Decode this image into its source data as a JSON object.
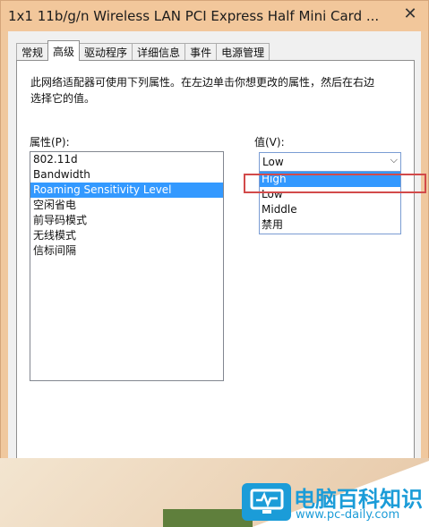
{
  "window": {
    "title": "1x1 11b/g/n Wireless LAN PCI Express Half Mini Card ...",
    "close_glyph": "✕"
  },
  "tabs": [
    {
      "label": "常规"
    },
    {
      "label": "高级"
    },
    {
      "label": "驱动程序"
    },
    {
      "label": "详细信息"
    },
    {
      "label": "事件"
    },
    {
      "label": "电源管理"
    }
  ],
  "advanced": {
    "description": "此网络适配器可使用下列属性。在左边单击你想更改的属性，然后在右边选择它的值。",
    "property_label": "属性(P):",
    "value_label": "值(V):",
    "properties": [
      "802.11d",
      "Bandwidth",
      "Roaming Sensitivity Level",
      "空闲省电",
      "前导码模式",
      "无线模式",
      "信标间隔"
    ],
    "selected_property": "Roaming Sensitivity Level",
    "current_value": "Low",
    "value_options": [
      "High",
      "Low",
      "Middle",
      "禁用"
    ],
    "highlighted_option": "High"
  },
  "watermark": {
    "name": "电脑百科知识",
    "url": "www.pc-daily.com"
  },
  "colors": {
    "selection": "#3399ff",
    "annotation": "#d24a4a",
    "brand": "#1b9cd8"
  }
}
